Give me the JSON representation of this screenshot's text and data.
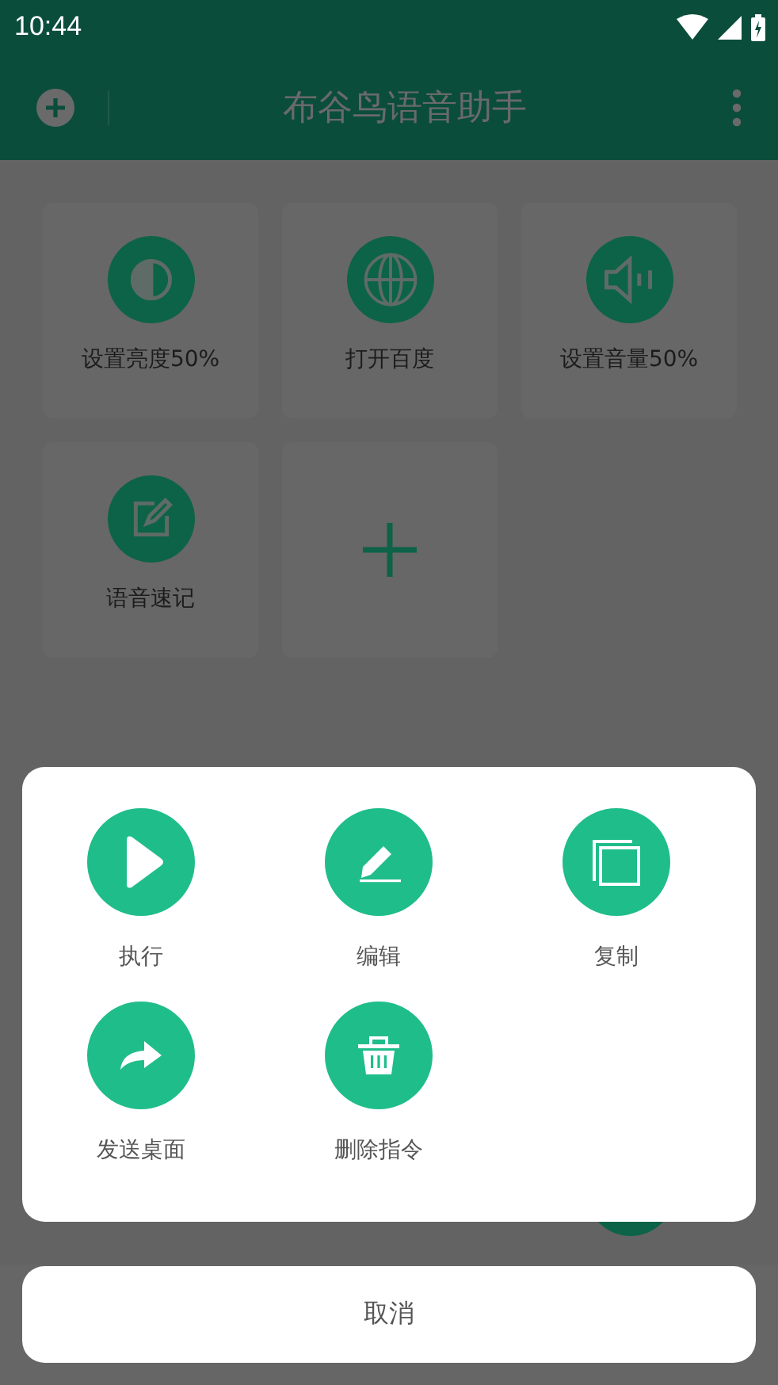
{
  "status_bar": {
    "time": "10:44"
  },
  "app_bar": {
    "title": "布谷鸟语音助手"
  },
  "commands": [
    {
      "kind": "command",
      "label": "设置亮度50%"
    },
    {
      "kind": "command",
      "label": "打开百度"
    },
    {
      "kind": "command",
      "label": "设置音量50%"
    },
    {
      "kind": "command",
      "label": "语音速记"
    },
    {
      "kind": "add"
    }
  ],
  "action_sheet": {
    "actions": [
      {
        "label": "执行"
      },
      {
        "label": "编辑"
      },
      {
        "label": "复制"
      },
      {
        "label": "发送桌面"
      },
      {
        "label": "删除指令"
      }
    ],
    "cancel": "取消"
  }
}
